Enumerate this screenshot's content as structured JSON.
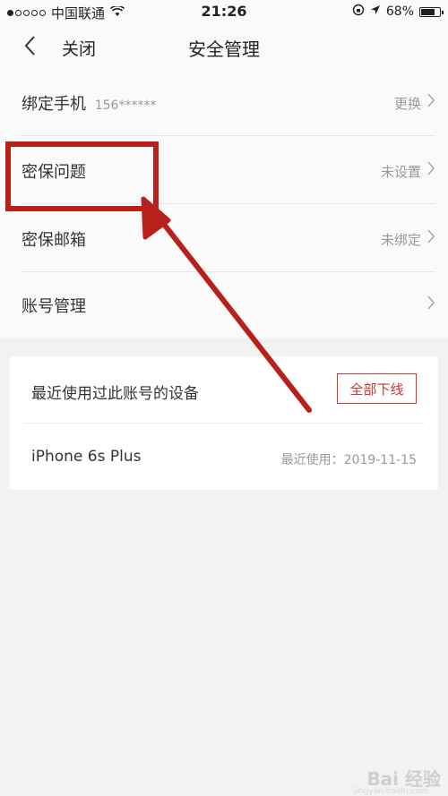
{
  "status_bar": {
    "carrier": "中国联通",
    "time": "21:26",
    "battery": "68%"
  },
  "nav": {
    "close_label": "关闭",
    "title": "安全管理"
  },
  "rows": [
    {
      "label": "绑定手机",
      "phone": "156******",
      "value": "更换"
    },
    {
      "label": "密保问题",
      "value": "未设置"
    },
    {
      "label": "密保邮箱",
      "value": "未绑定"
    },
    {
      "label": "账号管理",
      "value": ""
    }
  ],
  "devices": {
    "header": "最近使用过此账号的设备",
    "logout_all_label": "全部下线",
    "items": [
      {
        "name": "iPhone 6s Plus",
        "last_used": "最近使用：2019-11-15"
      }
    ]
  },
  "watermark": {
    "brand": "Bai 经验",
    "url": "jingyan.baidu.com"
  },
  "colors": {
    "accent": "#d0342c",
    "annotation": "#b8201c",
    "background": "#f2f2f2"
  },
  "icons": [
    "signal-icon",
    "wifi-icon",
    "lock-rotation-icon",
    "location-icon",
    "battery-icon",
    "back-icon",
    "chevron-right-icon"
  ]
}
